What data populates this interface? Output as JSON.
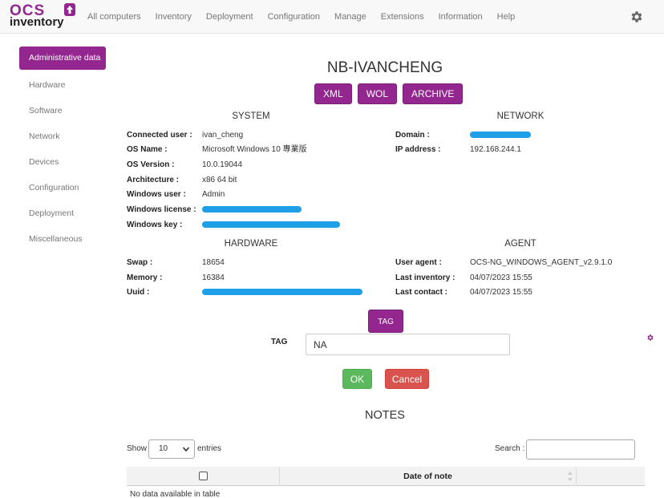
{
  "logo": {
    "line1": "OCS",
    "line2": "inventory",
    "brand_color": "#93278f"
  },
  "nav": {
    "items": [
      "All computers",
      "Inventory",
      "Deployment",
      "Configuration",
      "Manage",
      "Extensions",
      "Information",
      "Help"
    ],
    "settings_icon": "gear-icon"
  },
  "sidebar": {
    "items": [
      "Administrative data",
      "Hardware",
      "Software",
      "Network",
      "Devices",
      "Configuration",
      "Deployment",
      "Miscellaneous"
    ],
    "active": "Administrative data"
  },
  "computer": {
    "name": "NB-IVANCHENG",
    "actions": [
      "XML",
      "WOL",
      "ARCHIVE"
    ]
  },
  "system": {
    "heading": "SYSTEM",
    "rows": [
      {
        "label": "Connected user :",
        "value": "ivan_cheng"
      },
      {
        "label": "OS Name :",
        "value": "Microsoft Windows 10 專業版"
      },
      {
        "label": "OS Version :",
        "value": "10.0.19044"
      },
      {
        "label": "Architecture :",
        "value": "x86 64 bit"
      },
      {
        "label": "Windows user :",
        "value": "Admin"
      },
      {
        "label": "Windows license :",
        "value": ""
      },
      {
        "label": "Windows key :",
        "value": ""
      }
    ]
  },
  "network": {
    "heading": "NETWORK",
    "rows": [
      {
        "label": "Domain :",
        "value": ""
      },
      {
        "label": "IP address :",
        "value": "192.168.244.1"
      }
    ]
  },
  "hardware": {
    "heading": "HARDWARE",
    "rows": [
      {
        "label": "Swap :",
        "value": "18654"
      },
      {
        "label": "Memory :",
        "value": "16384"
      },
      {
        "label": "Uuid :",
        "value": ""
      }
    ]
  },
  "agent": {
    "heading": "AGENT",
    "rows": [
      {
        "label": "User agent :",
        "value": "OCS-NG_WINDOWS_AGENT_v2.9.1.0"
      },
      {
        "label": "Last inventory :",
        "value": "04/07/2023 15:55"
      },
      {
        "label": "Last contact :",
        "value": "04/07/2023 15:55"
      }
    ]
  },
  "tag": {
    "button": "TAG",
    "label": "TAG",
    "value": "NA",
    "ok": "OK",
    "cancel": "Cancel"
  },
  "notes": {
    "title": "NOTES",
    "show_label": "Show",
    "show_value": "10",
    "entries_label": "entries",
    "search_label": "Search :",
    "search_value": "",
    "columns": [
      "",
      "Date of note"
    ],
    "empty_message": "No data available in table"
  },
  "colors": {
    "primary": "#93278f",
    "ok": "#5cb85c",
    "cancel": "#d9534f",
    "redaction": "#1e9fe8"
  }
}
